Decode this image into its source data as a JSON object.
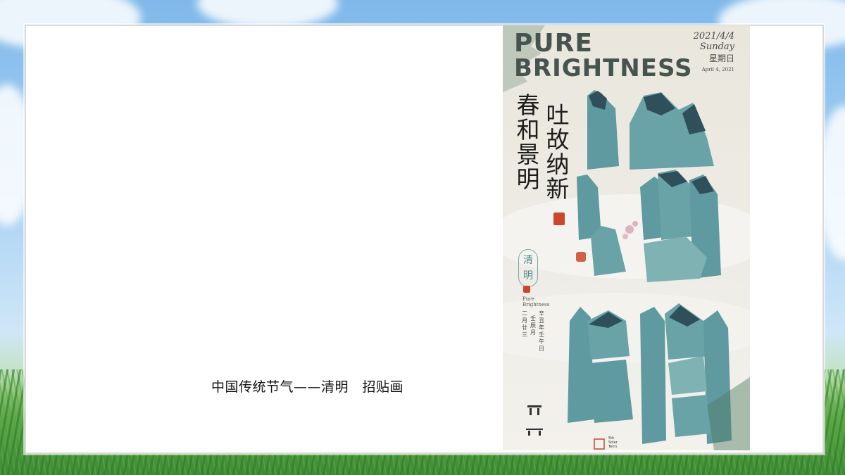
{
  "slide": {
    "caption": "中国传统节气——清明　招贴画"
  },
  "poster": {
    "title_line1": "PURE",
    "title_line2": "BRIGHTNESS",
    "date_numeric": "2021/4/4",
    "weekday_en": "Sunday",
    "weekday_cn": "星期日",
    "date_en": "April 4, 2021",
    "calligraphy_col1": "春和景明",
    "calligraphy_col2": "吐故纳新",
    "badge_chars": "清明",
    "subtitle_line1": "Pure",
    "subtitle_line2": "Brightness",
    "lunar_col1": "二月廿三",
    "lunar_col2": "壬辰月",
    "lunar_col3": "辛丑年壬午日",
    "solar_label_line1": "5th",
    "solar_label_line2": "Solar Term"
  },
  "colors": {
    "frame_bg": "#ffffff",
    "poster_title": "#46544f",
    "mountain_teal": "#5f9aa0",
    "mountain_dark": "#2f4f5a",
    "seal_red": "#c9472c"
  }
}
